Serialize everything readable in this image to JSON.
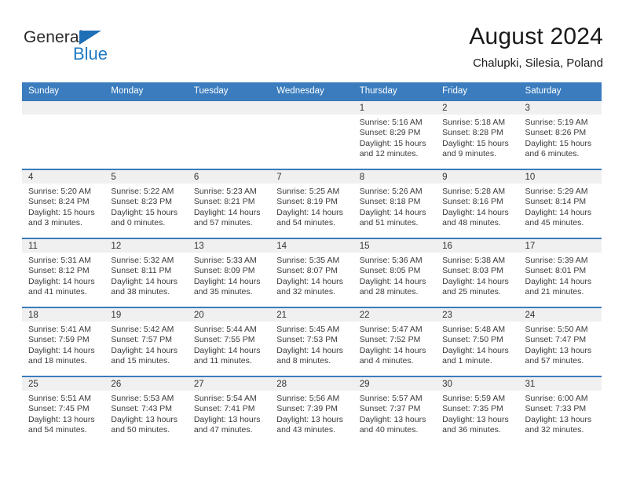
{
  "brand": {
    "name_part1": "General",
    "name_part2": "Blue",
    "accent_color": "#1f7ac4",
    "triangle_color": "#1f6fb6"
  },
  "header": {
    "title": "August 2024",
    "subtitle": "Chalupki, Silesia, Poland"
  },
  "calendar": {
    "header_bg": "#3a7cbe",
    "daynum_bg": "#f0f0f0",
    "weekdays": [
      "Sunday",
      "Monday",
      "Tuesday",
      "Wednesday",
      "Thursday",
      "Friday",
      "Saturday"
    ],
    "weeks": [
      [
        {
          "day": "",
          "empty": true
        },
        {
          "day": "",
          "empty": true
        },
        {
          "day": "",
          "empty": true
        },
        {
          "day": "",
          "empty": true
        },
        {
          "day": "1",
          "sunrise": "Sunrise: 5:16 AM",
          "sunset": "Sunset: 8:29 PM",
          "daylight_line1": "Daylight: 15 hours",
          "daylight_line2": "and 12 minutes."
        },
        {
          "day": "2",
          "sunrise": "Sunrise: 5:18 AM",
          "sunset": "Sunset: 8:28 PM",
          "daylight_line1": "Daylight: 15 hours",
          "daylight_line2": "and 9 minutes."
        },
        {
          "day": "3",
          "sunrise": "Sunrise: 5:19 AM",
          "sunset": "Sunset: 8:26 PM",
          "daylight_line1": "Daylight: 15 hours",
          "daylight_line2": "and 6 minutes."
        }
      ],
      [
        {
          "day": "4",
          "sunrise": "Sunrise: 5:20 AM",
          "sunset": "Sunset: 8:24 PM",
          "daylight_line1": "Daylight: 15 hours",
          "daylight_line2": "and 3 minutes."
        },
        {
          "day": "5",
          "sunrise": "Sunrise: 5:22 AM",
          "sunset": "Sunset: 8:23 PM",
          "daylight_line1": "Daylight: 15 hours",
          "daylight_line2": "and 0 minutes."
        },
        {
          "day": "6",
          "sunrise": "Sunrise: 5:23 AM",
          "sunset": "Sunset: 8:21 PM",
          "daylight_line1": "Daylight: 14 hours",
          "daylight_line2": "and 57 minutes."
        },
        {
          "day": "7",
          "sunrise": "Sunrise: 5:25 AM",
          "sunset": "Sunset: 8:19 PM",
          "daylight_line1": "Daylight: 14 hours",
          "daylight_line2": "and 54 minutes."
        },
        {
          "day": "8",
          "sunrise": "Sunrise: 5:26 AM",
          "sunset": "Sunset: 8:18 PM",
          "daylight_line1": "Daylight: 14 hours",
          "daylight_line2": "and 51 minutes."
        },
        {
          "day": "9",
          "sunrise": "Sunrise: 5:28 AM",
          "sunset": "Sunset: 8:16 PM",
          "daylight_line1": "Daylight: 14 hours",
          "daylight_line2": "and 48 minutes."
        },
        {
          "day": "10",
          "sunrise": "Sunrise: 5:29 AM",
          "sunset": "Sunset: 8:14 PM",
          "daylight_line1": "Daylight: 14 hours",
          "daylight_line2": "and 45 minutes."
        }
      ],
      [
        {
          "day": "11",
          "sunrise": "Sunrise: 5:31 AM",
          "sunset": "Sunset: 8:12 PM",
          "daylight_line1": "Daylight: 14 hours",
          "daylight_line2": "and 41 minutes."
        },
        {
          "day": "12",
          "sunrise": "Sunrise: 5:32 AM",
          "sunset": "Sunset: 8:11 PM",
          "daylight_line1": "Daylight: 14 hours",
          "daylight_line2": "and 38 minutes."
        },
        {
          "day": "13",
          "sunrise": "Sunrise: 5:33 AM",
          "sunset": "Sunset: 8:09 PM",
          "daylight_line1": "Daylight: 14 hours",
          "daylight_line2": "and 35 minutes."
        },
        {
          "day": "14",
          "sunrise": "Sunrise: 5:35 AM",
          "sunset": "Sunset: 8:07 PM",
          "daylight_line1": "Daylight: 14 hours",
          "daylight_line2": "and 32 minutes."
        },
        {
          "day": "15",
          "sunrise": "Sunrise: 5:36 AM",
          "sunset": "Sunset: 8:05 PM",
          "daylight_line1": "Daylight: 14 hours",
          "daylight_line2": "and 28 minutes."
        },
        {
          "day": "16",
          "sunrise": "Sunrise: 5:38 AM",
          "sunset": "Sunset: 8:03 PM",
          "daylight_line1": "Daylight: 14 hours",
          "daylight_line2": "and 25 minutes."
        },
        {
          "day": "17",
          "sunrise": "Sunrise: 5:39 AM",
          "sunset": "Sunset: 8:01 PM",
          "daylight_line1": "Daylight: 14 hours",
          "daylight_line2": "and 21 minutes."
        }
      ],
      [
        {
          "day": "18",
          "sunrise": "Sunrise: 5:41 AM",
          "sunset": "Sunset: 7:59 PM",
          "daylight_line1": "Daylight: 14 hours",
          "daylight_line2": "and 18 minutes."
        },
        {
          "day": "19",
          "sunrise": "Sunrise: 5:42 AM",
          "sunset": "Sunset: 7:57 PM",
          "daylight_line1": "Daylight: 14 hours",
          "daylight_line2": "and 15 minutes."
        },
        {
          "day": "20",
          "sunrise": "Sunrise: 5:44 AM",
          "sunset": "Sunset: 7:55 PM",
          "daylight_line1": "Daylight: 14 hours",
          "daylight_line2": "and 11 minutes."
        },
        {
          "day": "21",
          "sunrise": "Sunrise: 5:45 AM",
          "sunset": "Sunset: 7:53 PM",
          "daylight_line1": "Daylight: 14 hours",
          "daylight_line2": "and 8 minutes."
        },
        {
          "day": "22",
          "sunrise": "Sunrise: 5:47 AM",
          "sunset": "Sunset: 7:52 PM",
          "daylight_line1": "Daylight: 14 hours",
          "daylight_line2": "and 4 minutes."
        },
        {
          "day": "23",
          "sunrise": "Sunrise: 5:48 AM",
          "sunset": "Sunset: 7:50 PM",
          "daylight_line1": "Daylight: 14 hours",
          "daylight_line2": "and 1 minute."
        },
        {
          "day": "24",
          "sunrise": "Sunrise: 5:50 AM",
          "sunset": "Sunset: 7:47 PM",
          "daylight_line1": "Daylight: 13 hours",
          "daylight_line2": "and 57 minutes."
        }
      ],
      [
        {
          "day": "25",
          "sunrise": "Sunrise: 5:51 AM",
          "sunset": "Sunset: 7:45 PM",
          "daylight_line1": "Daylight: 13 hours",
          "daylight_line2": "and 54 minutes."
        },
        {
          "day": "26",
          "sunrise": "Sunrise: 5:53 AM",
          "sunset": "Sunset: 7:43 PM",
          "daylight_line1": "Daylight: 13 hours",
          "daylight_line2": "and 50 minutes."
        },
        {
          "day": "27",
          "sunrise": "Sunrise: 5:54 AM",
          "sunset": "Sunset: 7:41 PM",
          "daylight_line1": "Daylight: 13 hours",
          "daylight_line2": "and 47 minutes."
        },
        {
          "day": "28",
          "sunrise": "Sunrise: 5:56 AM",
          "sunset": "Sunset: 7:39 PM",
          "daylight_line1": "Daylight: 13 hours",
          "daylight_line2": "and 43 minutes."
        },
        {
          "day": "29",
          "sunrise": "Sunrise: 5:57 AM",
          "sunset": "Sunset: 7:37 PM",
          "daylight_line1": "Daylight: 13 hours",
          "daylight_line2": "and 40 minutes."
        },
        {
          "day": "30",
          "sunrise": "Sunrise: 5:59 AM",
          "sunset": "Sunset: 7:35 PM",
          "daylight_line1": "Daylight: 13 hours",
          "daylight_line2": "and 36 minutes."
        },
        {
          "day": "31",
          "sunrise": "Sunrise: 6:00 AM",
          "sunset": "Sunset: 7:33 PM",
          "daylight_line1": "Daylight: 13 hours",
          "daylight_line2": "and 32 minutes."
        }
      ]
    ]
  }
}
